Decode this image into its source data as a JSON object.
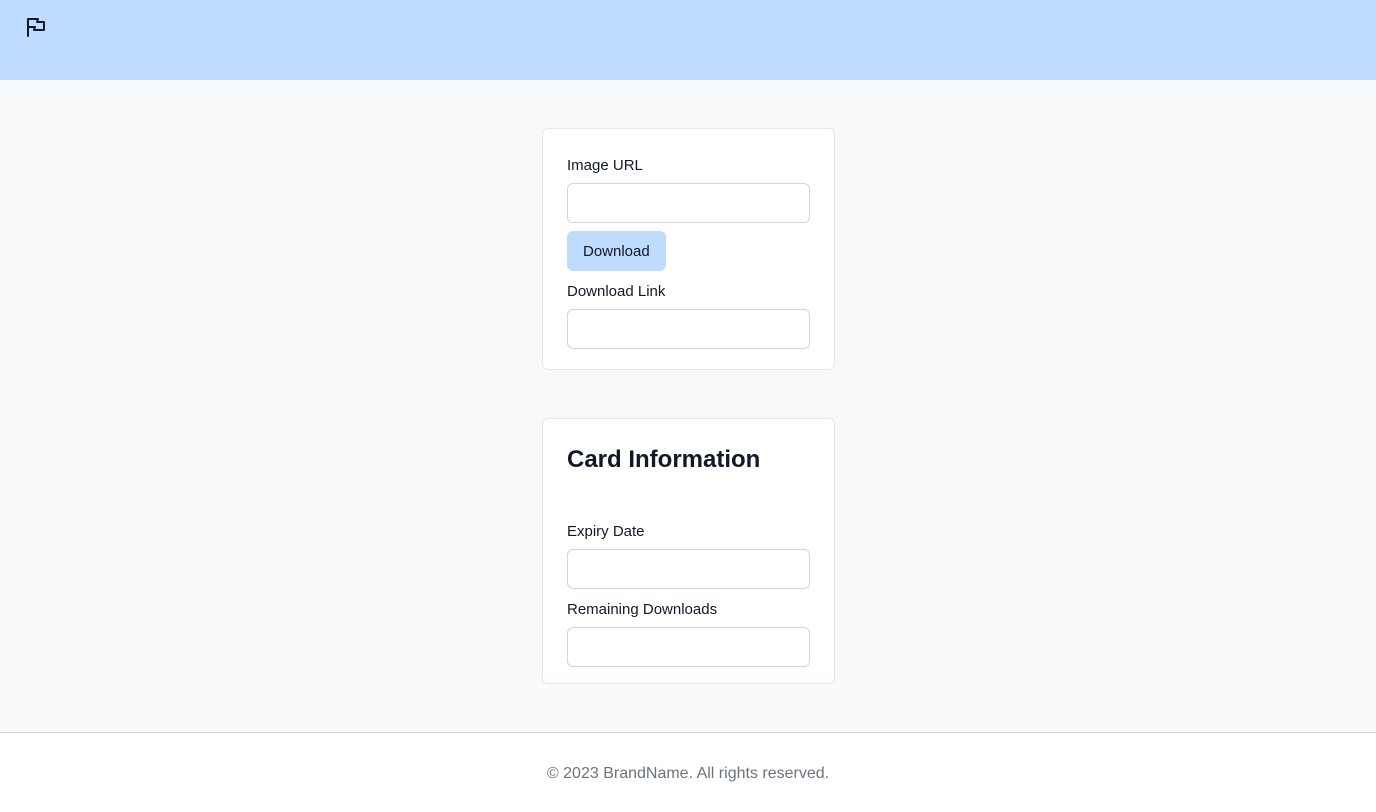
{
  "header": {
    "logo_icon": "flag-icon",
    "background_color": "#bfdbfe"
  },
  "download_card": {
    "image_url_label": "Image URL",
    "image_url_value": "",
    "download_button_label": "Download",
    "download_link_label": "Download Link",
    "download_link_value": ""
  },
  "info_card": {
    "title": "Card Information",
    "expiry_label": "Expiry Date",
    "expiry_value": "",
    "remaining_label": "Remaining Downloads",
    "remaining_value": ""
  },
  "footer": {
    "text": "© 2023 BrandName. All rights reserved."
  }
}
